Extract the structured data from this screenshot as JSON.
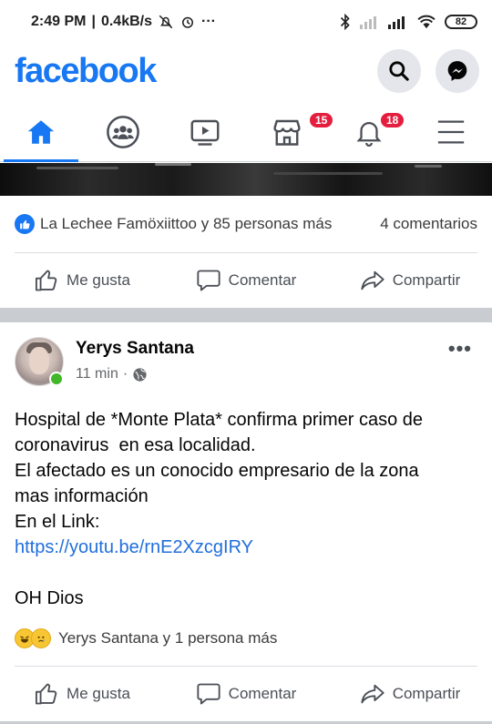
{
  "status_bar": {
    "time": "2:49 PM",
    "speed": "0.4kB/s",
    "battery": "82"
  },
  "app": {
    "logo": "facebook",
    "brand_color": "#1877f2"
  },
  "tabs": [
    {
      "name": "home",
      "icon": "home-icon",
      "active": true
    },
    {
      "name": "groups",
      "icon": "groups-icon"
    },
    {
      "name": "watch",
      "icon": "video-icon"
    },
    {
      "name": "marketplace",
      "icon": "store-icon",
      "badge": "15"
    },
    {
      "name": "notifications",
      "icon": "bell-icon",
      "badge": "18"
    },
    {
      "name": "menu",
      "icon": "hamburger-menu-icon"
    }
  ],
  "post1": {
    "reactions_text": "La Lechee Famöxiittoo y 85 personas más",
    "comments_text": "4 comentarios",
    "actions": {
      "like": "Me gusta",
      "comment": "Comentar",
      "share": "Compartir"
    }
  },
  "post2": {
    "author": "Yerys Santana",
    "time": "11 min",
    "text_lines": [
      "Hospital de *Monte Plata* confirma primer caso de",
      "coronavirus  en esa localidad.",
      "El afectado es un conocido empresario de la zona",
      "mas información",
      "En el Link:"
    ],
    "link": "https://youtu.be/rnE2XzcgIRY",
    "closing": "OH Dios",
    "reactions_text": "Yerys Santana y 1 persona más",
    "actions": {
      "like": "Me gusta",
      "comment": "Comentar",
      "share": "Compartir"
    }
  }
}
